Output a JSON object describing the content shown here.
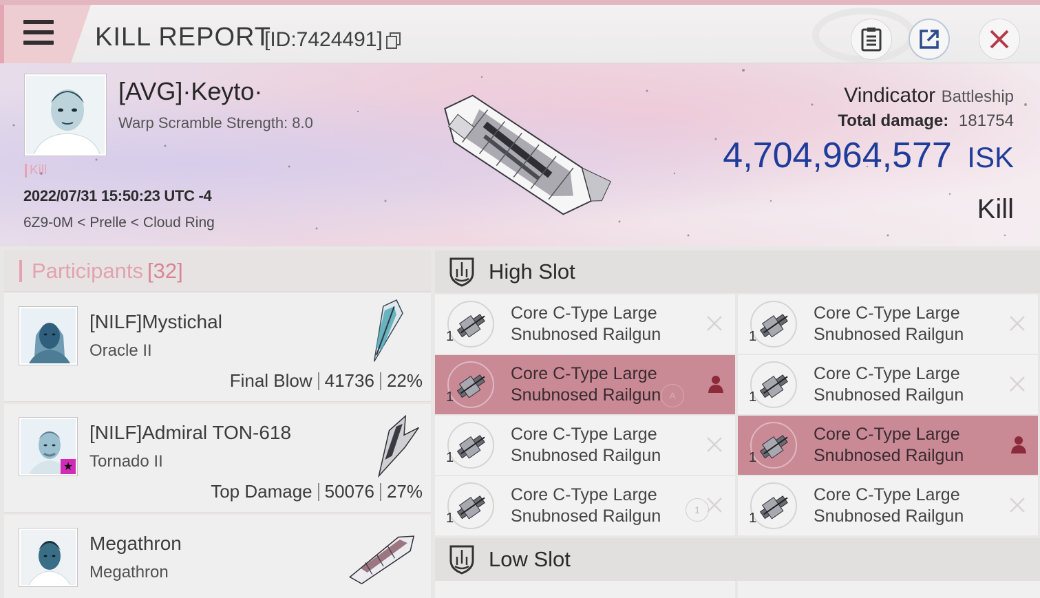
{
  "header": {
    "title": "KILL REPORT",
    "report_id": "[ID:7424491]"
  },
  "victim": {
    "name": "[AVG]·Keyto·",
    "warp_scramble": "Warp Scramble Strength: 8.0",
    "tag": "Kill",
    "datetime": "2022/07/31 15:50:23 UTC -4",
    "location": "6Z9-0M < Prelle < Cloud Ring",
    "ship_name": "Vindicator",
    "ship_class": "Battleship",
    "damage_label": "Total damage:",
    "damage_value": "181754",
    "isk_value": "4,704,964,577",
    "isk_unit": "ISK",
    "result": "Kill"
  },
  "participants": {
    "label": "Participants",
    "count": "[32]",
    "rows": [
      {
        "name": "[NILF]Mystichal",
        "ship": "Oracle II",
        "stat_label": "Final Blow",
        "damage": "41736",
        "percent": "22%"
      },
      {
        "name": "[NILF]Admiral TON-618",
        "ship": "Tornado II",
        "stat_label": "Top Damage",
        "damage": "50076",
        "percent": "27%"
      },
      {
        "name": "Megathron",
        "ship": "Megathron"
      }
    ]
  },
  "slots": {
    "high_label": "High Slot",
    "low_label": "Low Slot",
    "high": [
      {
        "qty": "1",
        "line1": "Core C-Type Large",
        "line2": "Snubnosed Railgun"
      },
      {
        "qty": "1",
        "line1": "Core C-Type Large",
        "line2": "Snubnosed Railgun"
      },
      {
        "qty": "1",
        "line1": "Core C-Type Large",
        "line2": "Snubnosed Railgun"
      },
      {
        "qty": "1",
        "line1": "Core C-Type Large",
        "line2": "Snubnosed Railgun"
      },
      {
        "qty": "1",
        "line1": "Core C-Type Large",
        "line2": "Snubnosed Railgun"
      },
      {
        "qty": "1",
        "line1": "Core C-Type Large",
        "line2": "Snubnosed Railgun"
      },
      {
        "qty": "1",
        "line1": "Core C-Type Large",
        "line2": "Snubnosed Railgun"
      },
      {
        "qty": "1",
        "line1": "Core C-Type Large",
        "line2": "Snubnosed Railgun"
      }
    ],
    "tag_a": "A",
    "tag_1": "1"
  },
  "colors": {
    "accent_pink": "#e3a2af",
    "highlight_row": "#c98a96",
    "isk_blue": "#1e3c9a"
  }
}
